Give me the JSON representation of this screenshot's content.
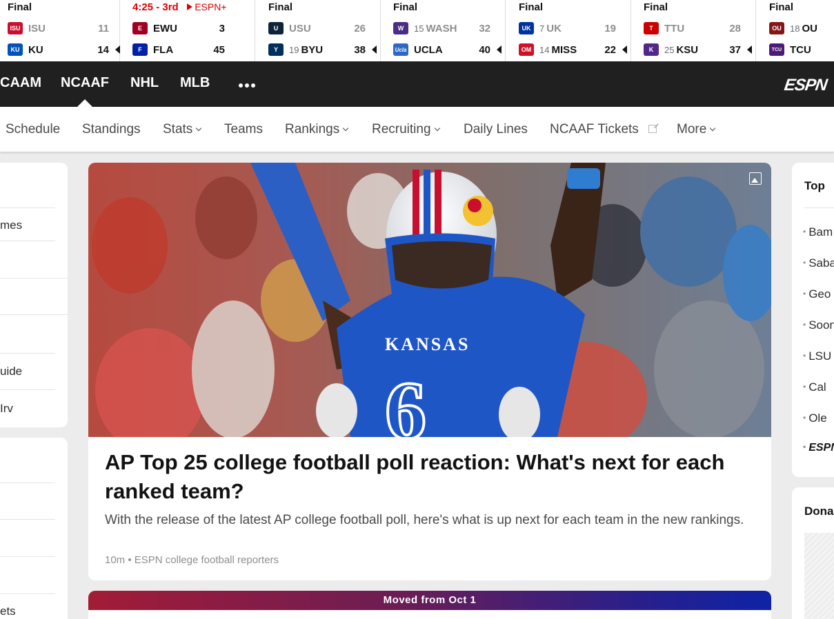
{
  "scoreboard": [
    {
      "status": "Final",
      "live": false,
      "teams": [
        {
          "rank": "",
          "abbr": "ISU",
          "score": "11",
          "winner": false,
          "color": "#c8102e",
          "logo_text": "ISU"
        },
        {
          "rank": "",
          "abbr": "KU",
          "score": "14",
          "winner": true,
          "color": "#0051ba",
          "logo_text": "KU"
        }
      ]
    },
    {
      "status": "4:25 - 3rd",
      "live": true,
      "network": "ESPN+",
      "teams": [
        {
          "rank": "",
          "abbr": "EWU",
          "score": "3",
          "winner": false,
          "color": "#a10022",
          "logo_text": "E"
        },
        {
          "rank": "",
          "abbr": "FLA",
          "score": "45",
          "winner": false,
          "color": "#0021a5",
          "logo_text": "F"
        }
      ]
    },
    {
      "status": "Final",
      "live": false,
      "teams": [
        {
          "rank": "",
          "abbr": "USU",
          "score": "26",
          "winner": false,
          "color": "#0f2439",
          "logo_text": "U"
        },
        {
          "rank": "19",
          "abbr": "BYU",
          "score": "38",
          "winner": true,
          "color": "#002e5d",
          "logo_text": "Y"
        }
      ]
    },
    {
      "status": "Final",
      "live": false,
      "teams": [
        {
          "rank": "15",
          "abbr": "WASH",
          "score": "32",
          "winner": false,
          "color": "#4b2e83",
          "logo_text": "W"
        },
        {
          "rank": "",
          "abbr": "UCLA",
          "score": "40",
          "winner": true,
          "color": "#2d68c4",
          "logo_text": "Ucla"
        }
      ]
    },
    {
      "status": "Final",
      "live": false,
      "teams": [
        {
          "rank": "7",
          "abbr": "UK",
          "score": "19",
          "winner": false,
          "color": "#0033a0",
          "logo_text": "UK"
        },
        {
          "rank": "14",
          "abbr": "MISS",
          "score": "22",
          "winner": true,
          "color": "#ce1126",
          "logo_text": "OM"
        }
      ]
    },
    {
      "status": "Final",
      "live": false,
      "teams": [
        {
          "rank": "",
          "abbr": "TTU",
          "score": "28",
          "winner": false,
          "color": "#cc0000",
          "logo_text": "T"
        },
        {
          "rank": "25",
          "abbr": "KSU",
          "score": "37",
          "winner": true,
          "color": "#512888",
          "logo_text": "K"
        }
      ]
    },
    {
      "status": "Final",
      "live": false,
      "teams": [
        {
          "rank": "18",
          "abbr": "OU",
          "score": "",
          "winner": false,
          "color": "#841617",
          "logo_text": "OU"
        },
        {
          "rank": "",
          "abbr": "TCU",
          "score": "",
          "winner": false,
          "color": "#4d1979",
          "logo_text": "TCU"
        }
      ]
    }
  ],
  "nav": {
    "items": [
      "CAAM",
      "NCAAF",
      "NHL",
      "MLB"
    ],
    "active": "NCAAF",
    "logo": "ESPN"
  },
  "subnav": {
    "items": [
      "Schedule",
      "Standings",
      "Stats",
      "Teams",
      "Rankings",
      "Recruiting",
      "Daily Lines",
      "NCAAF Tickets",
      "More"
    ]
  },
  "left_column": {
    "card1_items": [
      "mes",
      "uide",
      "Irv"
    ],
    "card2_items": [
      "ets"
    ]
  },
  "hero": {
    "jersey_text": "KANSAS",
    "jersey_number": "6",
    "headline": "AP Top 25 college football poll reaction: What's next for each ranked team?",
    "summary": "With the release of the latest AP college football poll, here's what is up next for each team in the new rankings.",
    "byline": "10m • ESPN college football reporters"
  },
  "moved_card": {
    "banner": "Moved from Oct 1"
  },
  "right_column": {
    "top_title": "Top",
    "top_items": [
      "Bam",
      "Saba",
      "Geo",
      "Soon",
      "LSU",
      "Cal",
      "Ole"
    ],
    "top_logo": "ESPN",
    "second_title": "Dona"
  },
  "colors": {
    "live": "#dd0000",
    "nav_bg": "#202020",
    "page_bg": "#ececec",
    "banner_start": "#a31c36",
    "banner_end": "#0e23a6"
  }
}
